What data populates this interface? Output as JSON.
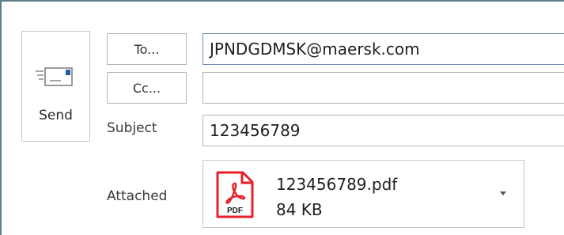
{
  "send": {
    "label": "Send",
    "icon": "send-envelope-icon"
  },
  "recipients": {
    "to_button": "To...",
    "to_value": "JPNDGDMSK@maersk.com",
    "cc_button": "Cc...",
    "cc_value": ""
  },
  "subject": {
    "label": "Subject",
    "value": "123456789"
  },
  "attachment": {
    "label": "Attached",
    "file_name": "123456789.pdf",
    "file_size": "84 KB",
    "icon": "pdf-file-icon",
    "icon_badge": "PDF",
    "dropdown_icon": "caret-down-icon"
  },
  "colors": {
    "frame_border": "#5d7e8a",
    "pdf_red": "#e8202a",
    "envelope_blue": "#1f5fa8"
  }
}
